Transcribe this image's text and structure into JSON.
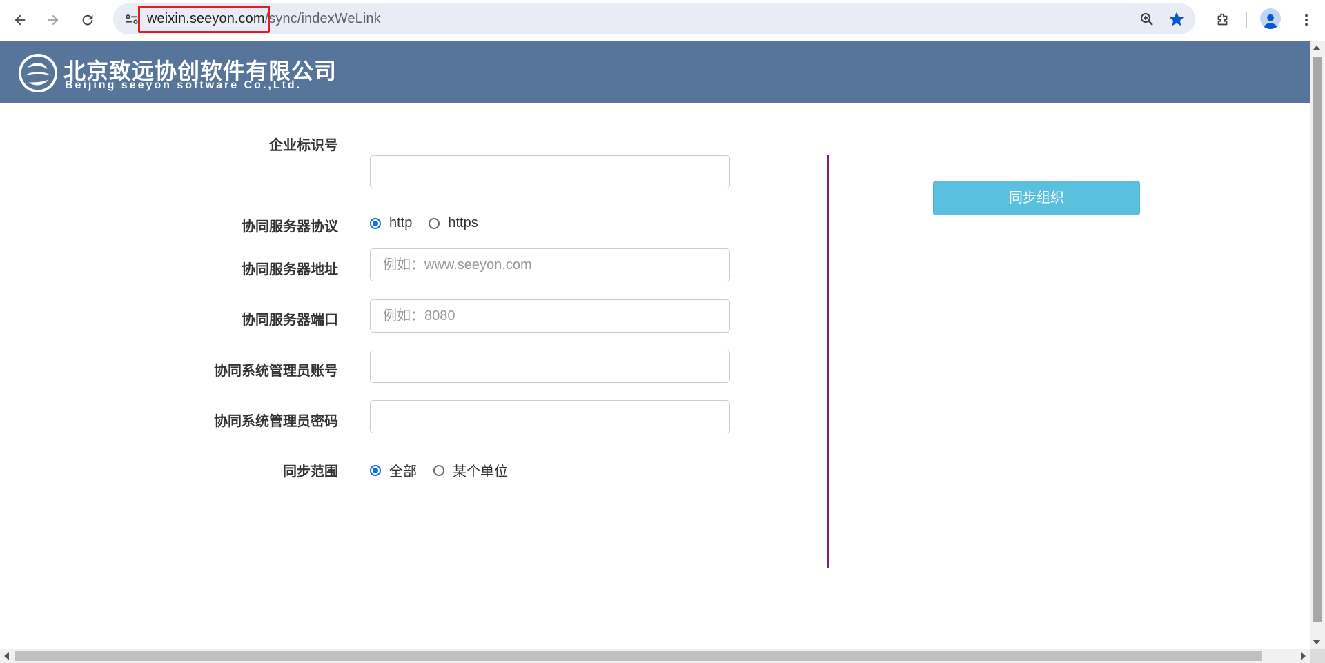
{
  "browser": {
    "url_domain": "weixin.seeyon.com",
    "url_path": "/sync/indexWeLink",
    "icons": [
      "back-icon",
      "forward-icon",
      "reload-icon",
      "site-info-icon",
      "zoom-icon",
      "bookmark-star-icon",
      "extensions-icon",
      "profile-icon",
      "menu-icon"
    ]
  },
  "banner": {
    "company_cn": "北京致远协创软件有限公司",
    "company_en": "Beijing seeyon software Co.,Ltd."
  },
  "form": {
    "corp_id": {
      "label": "企业标识号",
      "value": "",
      "placeholder": ""
    },
    "protocol": {
      "label": "协同服务器协议",
      "options": [
        "http",
        "https"
      ],
      "selected": "http"
    },
    "server_addr": {
      "label": "协同服务器地址",
      "value": "",
      "placeholder": "例如：www.seeyon.com"
    },
    "server_port": {
      "label": "协同服务器端口",
      "value": "",
      "placeholder": "例如：8080"
    },
    "admin_account": {
      "label": "协同系统管理员账号",
      "value": "",
      "placeholder": ""
    },
    "admin_password": {
      "label": "协同系统管理员密码",
      "value": "",
      "placeholder": ""
    },
    "sync_scope": {
      "label": "同步范围",
      "options": [
        "全部",
        "某个单位"
      ],
      "selected": "全部"
    }
  },
  "actions": {
    "sync_button": "同步组织"
  },
  "colors": {
    "banner": "#57759a",
    "accent_button": "#5bc0de",
    "divider": "#7a1f7a",
    "radio": "#0b6fe6",
    "url_highlight": "#e02020"
  }
}
